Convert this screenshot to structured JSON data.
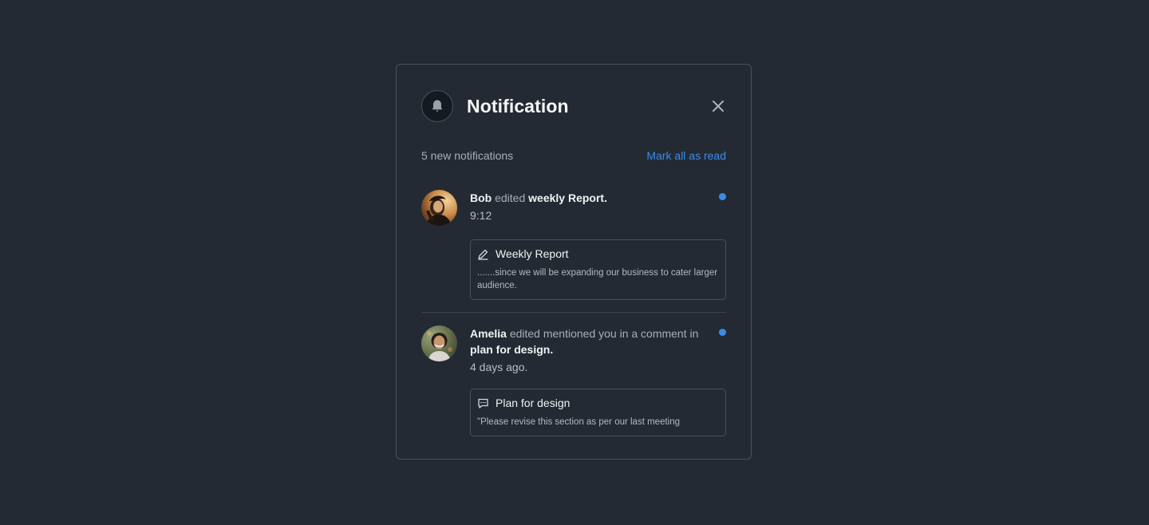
{
  "header": {
    "title": "Notification",
    "icon": "bell-icon",
    "close_icon": "close-icon"
  },
  "subbar": {
    "count_text": "5 new notifications",
    "mark_all_label": "Mark all as read"
  },
  "colors": {
    "accent": "#3b8bea",
    "background": "#242a33",
    "border": "#4a515c"
  },
  "notifications": [
    {
      "user": "Bob",
      "action": "edited",
      "target": "weekly Report.",
      "time": "9:12",
      "unread": true,
      "card": {
        "icon": "pencil-icon",
        "title": "Weekly Report",
        "body": ".......since we will be expanding our business to cater larger audience."
      }
    },
    {
      "user": "Amelia",
      "action": "edited mentioned you in a comment in",
      "target": "plan for design.",
      "time": "4 days ago.",
      "unread": true,
      "card": {
        "icon": "comment-icon",
        "title": "Plan for design",
        "body": "\"Please revise this section as per our last meeting"
      }
    }
  ]
}
